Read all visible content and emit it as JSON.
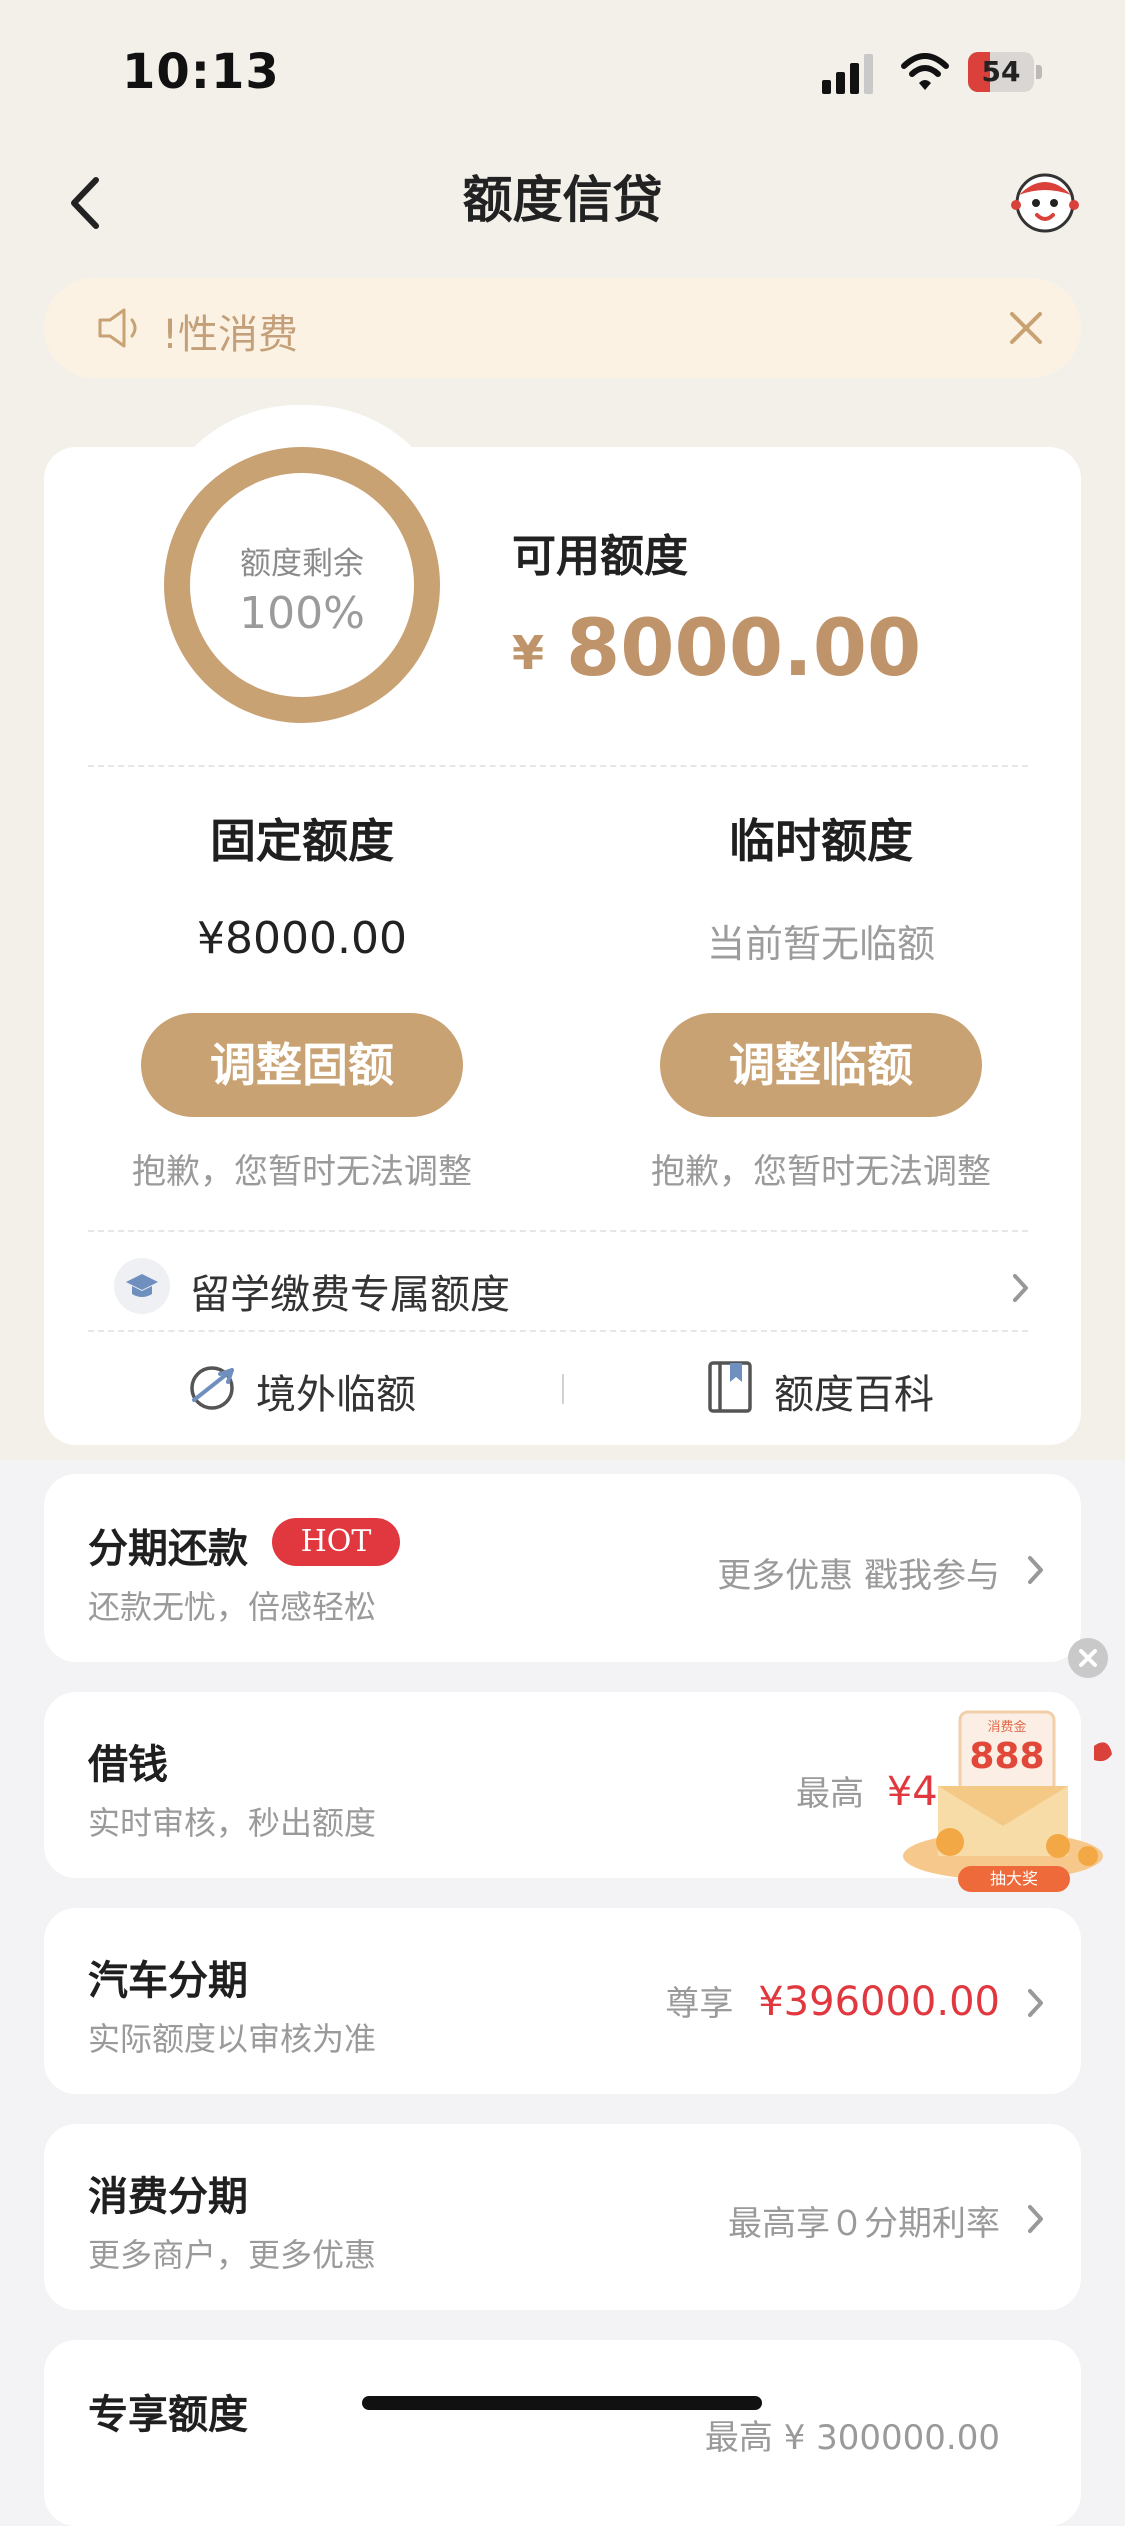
{
  "status_bar": {
    "time": "10:13",
    "battery": "54"
  },
  "nav": {
    "title": "额度信贷"
  },
  "notice": {
    "text": "!性消费"
  },
  "quota": {
    "ring_label": "额度剩余",
    "ring_value": "100%",
    "remaining_percent": 100,
    "available_label": "可用额度",
    "currency": "¥",
    "available_amount": "8000.00",
    "fixed": {
      "title": "固定额度",
      "value": "¥8000.00",
      "button": "调整固额",
      "note": "抱歉，您暂时无法调整"
    },
    "temporary": {
      "title": "临时额度",
      "value": "当前暂无临额",
      "button": "调整临额",
      "note": "抱歉，您暂时无法调整"
    },
    "study_abroad": "留学缴费专属额度",
    "overseas": "境外临额",
    "wiki": "额度百科"
  },
  "services": [
    {
      "title": "分期还款",
      "badge": "HOT",
      "subtitle": "还款无忧，倍感轻松",
      "right_text": "更多优惠 戳我参与"
    },
    {
      "title": "借钱",
      "subtitle": "实时审核，秒出额度",
      "right_prefix": "最高",
      "right_amount": "¥4"
    },
    {
      "title": "汽车分期",
      "subtitle": "实际额度以审核为准",
      "right_prefix": "尊享",
      "right_amount": "¥396000.00"
    },
    {
      "title": "消费分期",
      "subtitle": "更多商户，更多优惠",
      "right_text": "最高享０分期利率"
    },
    {
      "title": "专享额度",
      "right_text": "最高 ¥ 300000.00"
    }
  ],
  "promo": {
    "amount": "888",
    "badge_top": "消费金",
    "button": "抽大奖"
  },
  "colors": {
    "accent": "#c9a274",
    "amount_gold": "#bf946a",
    "hot_red": "#e0383e",
    "notice_bg": "#fbf2e3"
  }
}
